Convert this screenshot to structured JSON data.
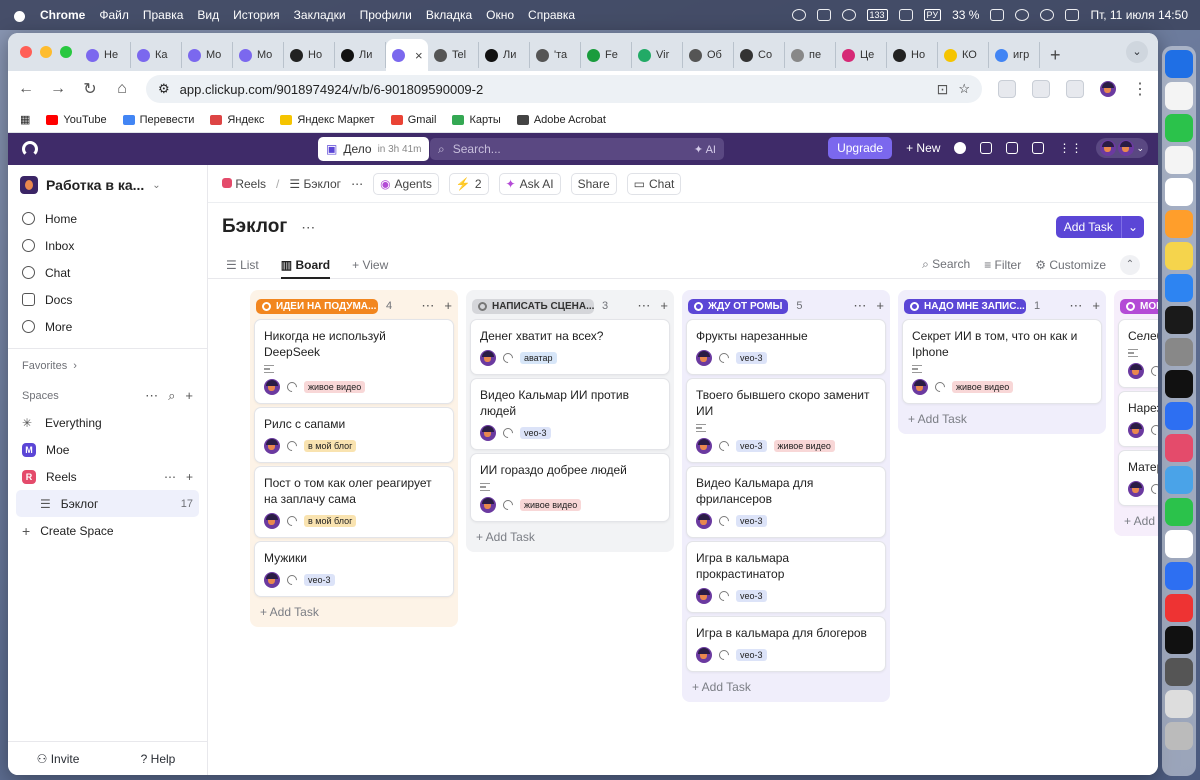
{
  "menubar": {
    "items": [
      "Chrome",
      "Файл",
      "Правка",
      "Вид",
      "История",
      "Закладки",
      "Профили",
      "Вкладка",
      "Окно",
      "Справка"
    ],
    "battery": "33 %",
    "lang": "РУ",
    "datetime": "Пт, 11 июля  14:50",
    "badge": "133"
  },
  "browser": {
    "tabs": [
      {
        "label": "Не"
      },
      {
        "label": "Ка"
      },
      {
        "label": "Mo"
      },
      {
        "label": "Mo"
      },
      {
        "label": "Но"
      },
      {
        "label": "Ли"
      },
      {
        "label": "",
        "active": true
      },
      {
        "label": "Tel"
      },
      {
        "label": "Ли"
      },
      {
        "label": "'та"
      },
      {
        "label": "Fe"
      },
      {
        "label": "Vir"
      },
      {
        "label": "Об"
      },
      {
        "label": "Со"
      },
      {
        "label": "пе"
      },
      {
        "label": "Це"
      },
      {
        "label": "Но"
      },
      {
        "label": "КО"
      },
      {
        "label": "игр"
      }
    ],
    "url": "app.clickup.com/9018974924/v/b/6-901809590009-2",
    "bookmarks": [
      {
        "label": "YouTube",
        "color": "#ff0000"
      },
      {
        "label": "Перевести",
        "color": "#4285f4"
      },
      {
        "label": "Яндекс",
        "color": "#d44"
      },
      {
        "label": "Яндекс Маркет",
        "color": "#f5c400"
      },
      {
        "label": "Gmail",
        "color": "#ea4335"
      },
      {
        "label": "Карты",
        "color": "#34a853"
      },
      {
        "label": "Adobe Acrobat",
        "color": "#444"
      }
    ]
  },
  "topbar": {
    "deadline_label": "Дело",
    "deadline_time": "in 3h 41m",
    "search_placeholder": "Search...",
    "ai_label": "AI",
    "upgrade": "Upgrade",
    "new": "+ New"
  },
  "sidebar": {
    "workspace": "Работка в ка...",
    "nav": [
      {
        "label": "Home"
      },
      {
        "label": "Inbox"
      },
      {
        "label": "Chat"
      },
      {
        "label": "Docs"
      },
      {
        "label": "More"
      }
    ],
    "favorites": "Favorites",
    "spaces": "Spaces",
    "space_items": [
      {
        "label": "Everything",
        "icon": "✳"
      },
      {
        "label": "Мое",
        "letter": "M",
        "color": "#5b46d6"
      },
      {
        "label": "Reels",
        "letter": "R",
        "color": "#e44b6b"
      }
    ],
    "list_item": {
      "label": "Бэклог",
      "count": "17"
    },
    "create": "Create Space",
    "invite": "Invite",
    "help": "Help"
  },
  "crumbs": {
    "space": "Reels",
    "list": "Бэклог",
    "agents": "Agents",
    "bolt_count": "2",
    "ask_ai": "Ask AI",
    "share": "Share",
    "chat": "Chat"
  },
  "page": {
    "title": "Бэклог",
    "add_task": "Add Task"
  },
  "views": {
    "list": "List",
    "board": "Board",
    "add": "View",
    "search": "Search",
    "filter": "Filter",
    "customize": "Customize"
  },
  "columns": [
    {
      "status": "ИДЕИ НА ПОДУМА...",
      "count": "4",
      "color": "#f2861f",
      "bg": "#fdf3e7",
      "cards": [
        {
          "title": "Никогда не используй DeepSeek",
          "desc": true,
          "tag": "живое видео",
          "tag_color": "#f8d7d7"
        },
        {
          "title": "Рилс с сапами",
          "tag": "в мой блог",
          "tag_color": "#f9e3b0"
        },
        {
          "title": "Пост о том как олег реагирует на заплачу сама",
          "tag": "в мой блог",
          "tag_color": "#f9e3b0"
        },
        {
          "title": "Мужики",
          "tag": "veo-3",
          "tag_color": "#dce3f8"
        }
      ]
    },
    {
      "status": "НАПИСАТЬ СЦЕНА...",
      "count": "3",
      "color": "#d5d6da",
      "text": "#333",
      "bg": "#f2f3f5",
      "cards": [
        {
          "title": "Денег хватит на всех?",
          "tag": "аватар",
          "tag_color": "#d7e6f8"
        },
        {
          "title": "Видео Кальмар ИИ против людей",
          "tag": "veo-3",
          "tag_color": "#dce3f8"
        },
        {
          "title": "ИИ гораздо добрее людей",
          "desc": true,
          "tag": "живое видео",
          "tag_color": "#f8d7d7"
        }
      ]
    },
    {
      "status": "ЖДУ ОТ РОМЫ",
      "count": "5",
      "color": "#5b46d6",
      "bg": "#f0eefb",
      "cards": [
        {
          "title": "Фрукты нарезанные",
          "tag": "veo-3",
          "tag_color": "#dce3f8"
        },
        {
          "title": "Твоего бывшего скоро заменит ИИ",
          "desc": true,
          "tag": "veo-3",
          "tag_color": "#dce3f8",
          "tag2": "живое видео",
          "tag2_color": "#f8d7d7"
        },
        {
          "title": "Видео Кальмара для фрилансеров",
          "tag": "veo-3",
          "tag_color": "#dce3f8"
        },
        {
          "title": "Игра в кальмара прокрастинатор",
          "tag": "veo-3",
          "tag_color": "#dce3f8"
        },
        {
          "title": "Игра в кальмара для блогеров",
          "tag": "veo-3",
          "tag_color": "#dce3f8"
        }
      ]
    },
    {
      "status": "НАДО МНЕ ЗАПИС...",
      "count": "1",
      "color": "#5b46d6",
      "bg": "#f0eefb",
      "cards": [
        {
          "title": "Секрет ИИ в том, что он как и Iphone",
          "desc": true,
          "tag": "живое видео",
          "tag_color": "#f8d7d7"
        }
      ]
    },
    {
      "status": "МОИ",
      "count": "",
      "color": "#b44bd6",
      "bg": "#f6eefb",
      "cards": [
        {
          "title": "Селеб",
          "desc": true,
          "tag": "",
          "tag_color": "#dce3f8"
        },
        {
          "title": "Нарез \"дело",
          "tag": "",
          "tag_color": "#dce3f8"
        },
        {
          "title": "Матер",
          "tag": "",
          "tag_color": "#dce3f8"
        }
      ]
    }
  ],
  "add_task_label": "+ Add Task"
}
